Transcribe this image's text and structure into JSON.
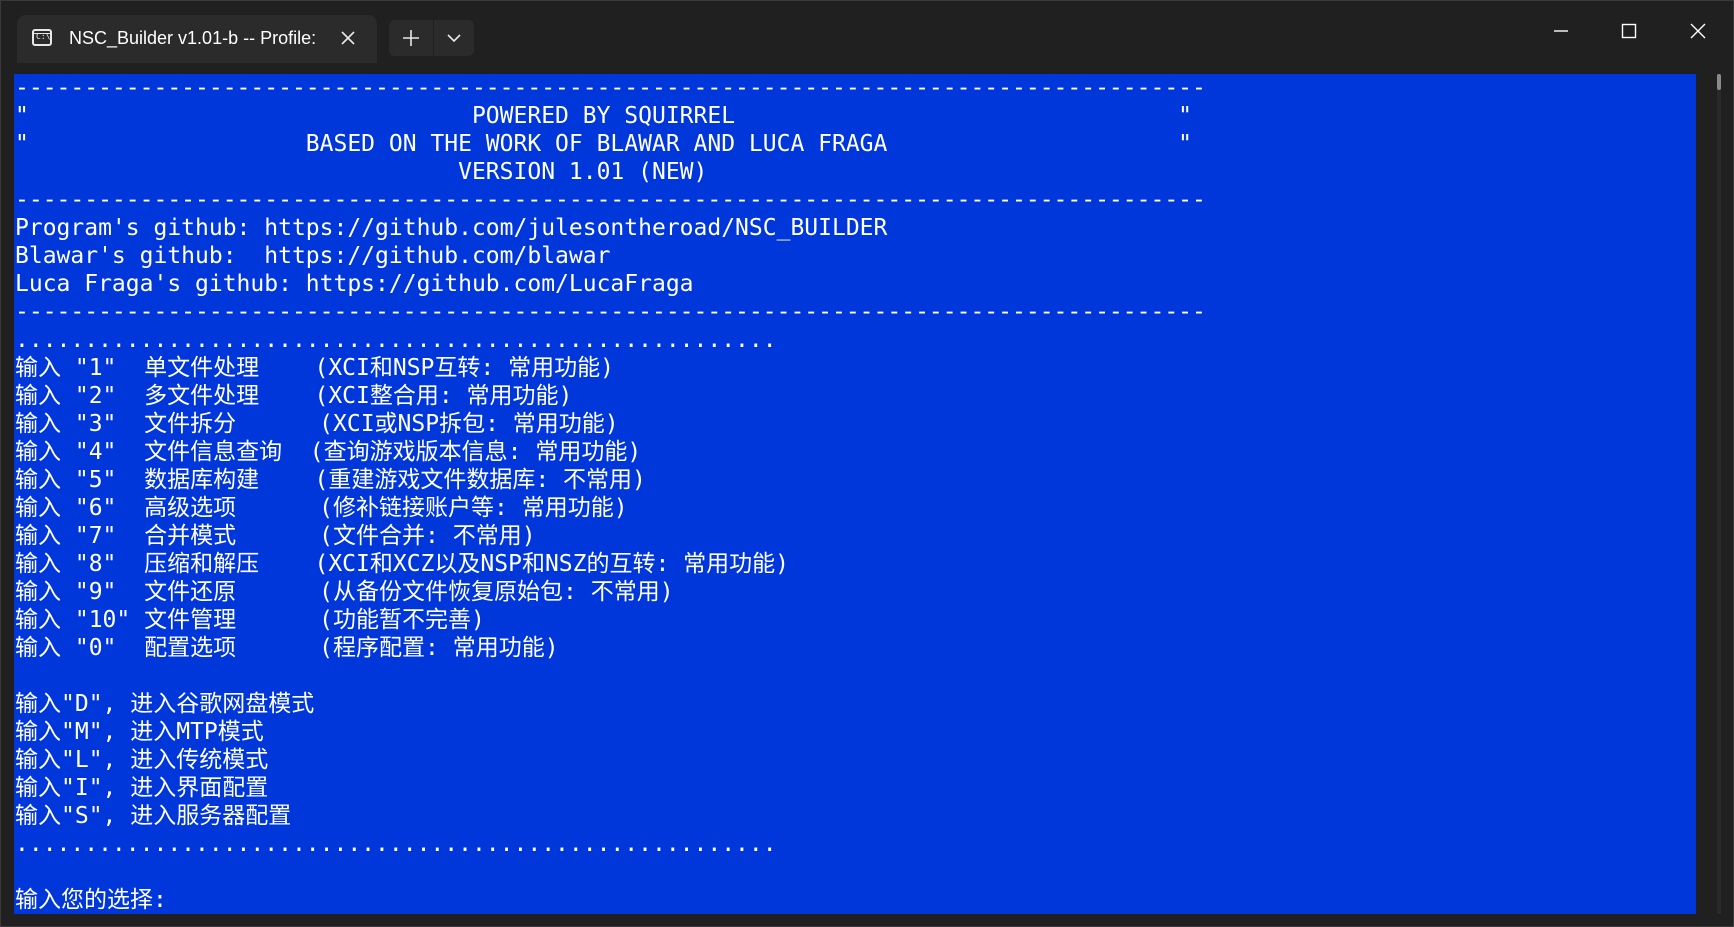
{
  "window": {
    "tab_title": "NSC_Builder v1.01-b -- Profile:",
    "icons": {
      "tab_icon": "terminal-icon",
      "close_tab": "close-icon",
      "new_tab": "plus-icon",
      "tab_dropdown": "chevron-down-icon",
      "minimize": "minimize-icon",
      "maximize": "maximize-icon",
      "close_window": "close-icon"
    }
  },
  "colors": {
    "console_background": "#0037da",
    "console_text": "#ffffff",
    "titlebar": "#202020",
    "tab": "#2b2b2b"
  },
  "console": {
    "lines": [
      "--------------------------------------------------------------------------------------",
      "\"                                POWERED BY SQUIRREL                                \"",
      "\"                    BASED ON THE WORK OF BLAWAR AND LUCA FRAGA                     \"",
      "                                VERSION 1.01 (NEW)",
      "--------------------------------------------------------------------------------------",
      "Program's github: https://github.com/julesontheroad/NSC_BUILDER",
      "Blawar's github:  https://github.com/blawar",
      "Luca Fraga's github: https://github.com/LucaFraga",
      "--------------------------------------------------------------------------------------",
      ".......................................................",
      "输入 \"1\"  单文件处理    (XCI和NSP互转: 常用功能)",
      "输入 \"2\"  多文件处理    (XCI整合用: 常用功能)",
      "输入 \"3\"  文件拆分      (XCI或NSP拆包: 常用功能)",
      "输入 \"4\"  文件信息查询  (查询游戏版本信息: 常用功能)",
      "输入 \"5\"  数据库构建    (重建游戏文件数据库: 不常用)",
      "输入 \"6\"  高级选项      (修补链接账户等: 常用功能)",
      "输入 \"7\"  合并模式      (文件合并: 不常用)",
      "输入 \"8\"  压缩和解压    (XCI和XCZ以及NSP和NSZ的互转: 常用功能)",
      "输入 \"9\"  文件还原      (从备份文件恢复原始包: 不常用)",
      "输入 \"10\" 文件管理      (功能暂不完善)",
      "输入 \"0\"  配置选项      (程序配置: 常用功能)",
      "",
      "输入\"D\", 进入谷歌网盘模式",
      "输入\"M\", 进入MTP模式",
      "输入\"L\", 进入传统模式",
      "输入\"I\", 进入界面配置",
      "输入\"S\", 进入服务器配置",
      ".......................................................",
      "",
      "输入您的选择:"
    ]
  }
}
